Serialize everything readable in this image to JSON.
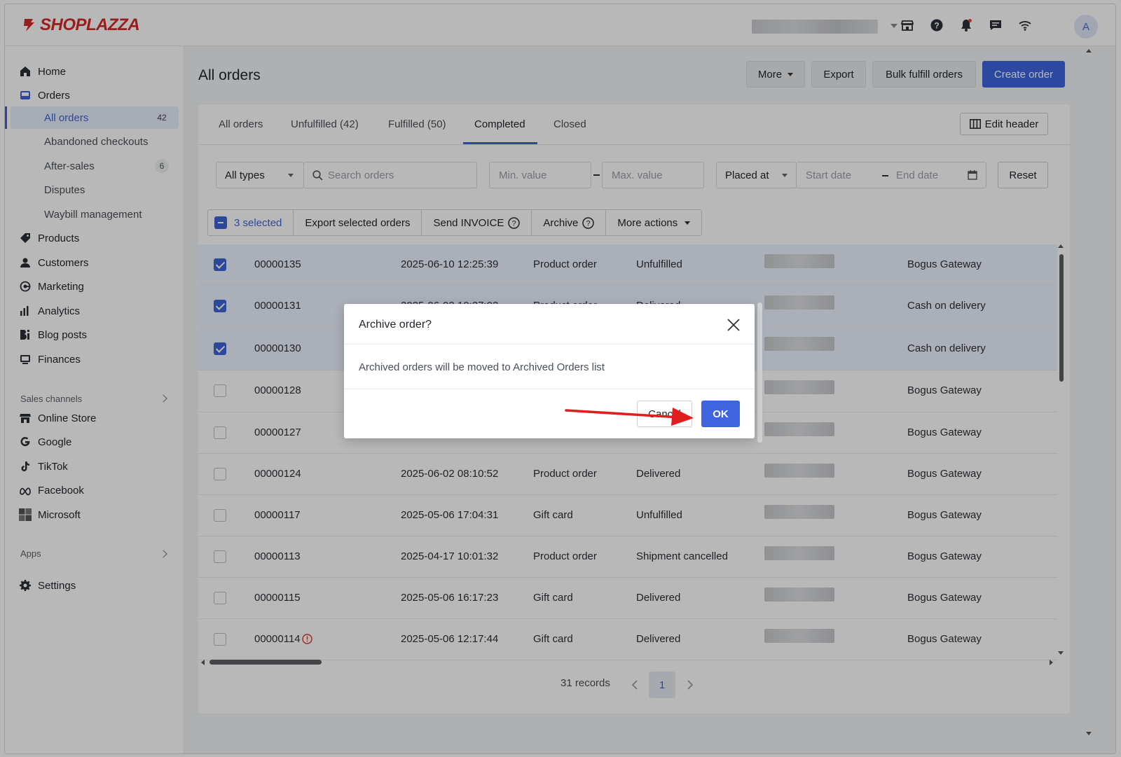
{
  "app": {
    "brand": "SHOPLAZZA",
    "brand_color": "#d32a2a",
    "accent_color": "#3e64e0",
    "avatar_letter": "A"
  },
  "topbar": {
    "icons": [
      "store-icon",
      "help-icon",
      "bell-icon",
      "message-icon",
      "wifi-icon"
    ]
  },
  "sidebar": {
    "home": "Home",
    "orders": "Orders",
    "sub": [
      {
        "label": "All orders",
        "count": "42"
      },
      {
        "label": "Abandoned checkouts",
        "count": ""
      },
      {
        "label": "After-sales",
        "count": "6"
      },
      {
        "label": "Disputes",
        "count": ""
      },
      {
        "label": "Waybill management",
        "count": ""
      }
    ],
    "products": "Products",
    "customers": "Customers",
    "marketing": "Marketing",
    "analytics": "Analytics",
    "blog": "Blog posts",
    "finances": "Finances",
    "sales_channels": "Sales channels",
    "channels": [
      "Online Store",
      "Google",
      "TikTok",
      "Facebook",
      "Microsoft"
    ],
    "apps": "Apps",
    "settings": "Settings"
  },
  "header": {
    "title": "All orders",
    "more": "More",
    "export": "Export",
    "bulk_fulfill": "Bulk fulfill orders",
    "create": "Create order"
  },
  "tabs": [
    "All orders",
    "Unfulfilled  (42)",
    "Fulfilled  (50)",
    "Completed",
    "Closed"
  ],
  "edit_header": "Edit header",
  "filters": {
    "type": "All types",
    "search_placeholder": "Search orders",
    "min_placeholder": "Min. value",
    "max_placeholder": "Max. value",
    "placed_at": "Placed at",
    "start_date": "Start date",
    "end_date": "End date",
    "reset": "Reset"
  },
  "bulk": {
    "selected": "3 selected",
    "export_selected": "Export selected orders",
    "send_invoice": "Send INVOICE",
    "archive": "Archive",
    "more_actions": "More actions"
  },
  "orders": [
    {
      "id": "00000135",
      "date": "2025-06-10 12:25:39",
      "type": "Product order",
      "status": "Unfulfilled",
      "gateway": "Bogus Gateway",
      "selected": true
    },
    {
      "id": "00000131",
      "date": "2025-06-02 10:27:02",
      "type": "Product order",
      "status": "Delivered",
      "gateway": "Cash on delivery",
      "selected": true
    },
    {
      "id": "00000130",
      "date": "",
      "type": "",
      "status": "",
      "gateway": "Cash on delivery",
      "selected": true
    },
    {
      "id": "00000128",
      "date": "",
      "type": "",
      "status": "",
      "gateway": "Bogus Gateway",
      "selected": false
    },
    {
      "id": "00000127",
      "date": "",
      "type": "",
      "status": "",
      "gateway": "Bogus Gateway",
      "selected": false
    },
    {
      "id": "00000124",
      "date": "2025-06-02 08:10:52",
      "type": "Product order",
      "status": "Delivered",
      "gateway": "Bogus Gateway",
      "selected": false
    },
    {
      "id": "00000117",
      "date": "2025-05-06 17:04:31",
      "type": "Gift card",
      "status": "Unfulfilled",
      "gateway": "Bogus Gateway",
      "selected": false
    },
    {
      "id": "00000113",
      "date": "2025-04-17 10:01:32",
      "type": "Product order",
      "status": "Shipment cancelled",
      "gateway": "Bogus Gateway",
      "selected": false
    },
    {
      "id": "00000115",
      "date": "2025-05-06 16:17:23",
      "type": "Gift card",
      "status": "Delivered",
      "gateway": "Bogus Gateway",
      "selected": false
    },
    {
      "id": "00000114",
      "date": "2025-05-06 12:17:44",
      "type": "Gift card",
      "status": "Delivered",
      "gateway": "Bogus Gateway",
      "selected": false
    }
  ],
  "pagination": {
    "records": "31 records",
    "page": "1"
  },
  "modal": {
    "title": "Archive order?",
    "body": "Archived orders will be moved to Archived Orders list",
    "cancel": "Cancel",
    "ok": "OK"
  }
}
